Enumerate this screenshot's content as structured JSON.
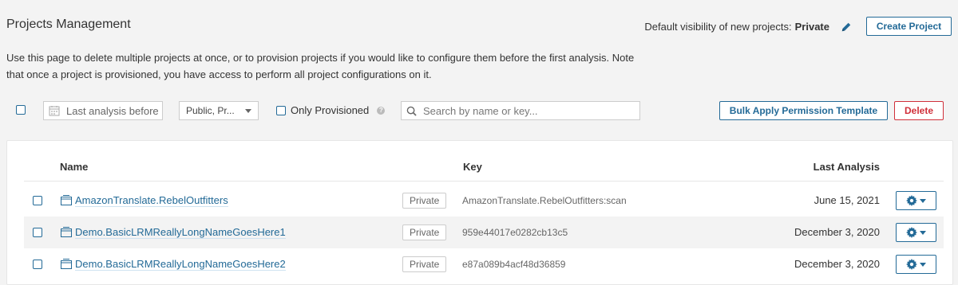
{
  "header": {
    "title": "Projects Management",
    "visibility_label": "Default visibility of new projects:",
    "visibility_value": "Private",
    "create_label": "Create Project"
  },
  "description": "Use this page to delete multiple projects at once, or to provision projects if you would like to configure them before the first analysis. Note that once a project is provisioned, you have access to perform all project configurations on it.",
  "filters": {
    "date_placeholder": "Last analysis before",
    "visibility_select": "Public, Pr...",
    "only_provisioned_label": "Only Provisioned",
    "search_placeholder": "Search by name or key...",
    "bulk_apply_label": "Bulk Apply Permission Template",
    "delete_label": "Delete"
  },
  "table": {
    "headers": {
      "name": "Name",
      "key": "Key",
      "last_analysis": "Last Analysis"
    },
    "rows": [
      {
        "name": "AmazonTranslate.RebelOutfitters",
        "visibility": "Private",
        "key": "AmazonTranslate.RebelOutfitters:scan",
        "last_analysis": "June 15, 2021"
      },
      {
        "name": "Demo.BasicLRMReallyLongNameGoesHere1",
        "visibility": "Private",
        "key": "959e44017e0282cb13c5",
        "last_analysis": "December 3, 2020"
      },
      {
        "name": "Demo.BasicLRMReallyLongNameGoesHere2",
        "visibility": "Private",
        "key": "e87a089b4acf48d36859",
        "last_analysis": "December 3, 2020"
      }
    ]
  },
  "colors": {
    "accent": "#236a97",
    "danger": "#d02f3a",
    "background": "#f3f3f3"
  },
  "icons": [
    "pencil-icon",
    "calendar-icon",
    "help-icon",
    "search-icon",
    "project-icon",
    "gear-icon",
    "chevron-down-icon"
  ]
}
